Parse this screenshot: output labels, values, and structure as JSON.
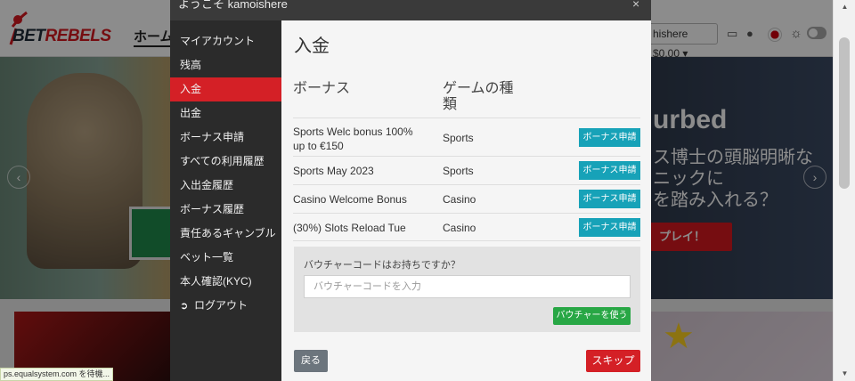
{
  "header": {
    "brand_prefix": "BET",
    "brand_suffix": "REBELS",
    "nav_home": "ホーム",
    "balance": "hishere $0.00 ▾"
  },
  "hero": {
    "title": "urbed",
    "lines": [
      "ス博士の頭脳明晰な",
      "ニックに",
      "を踏み入れる？"
    ],
    "play_button": "プレイ！",
    "prev_arrow": "‹",
    "next_arrow": "›"
  },
  "modal": {
    "welcome": "ようこそ kamoishere",
    "close": "×",
    "sidebar": [
      "マイアカウント",
      "残高",
      "入金",
      "出金",
      "ボーナス申請",
      "すべての利用履歴",
      "入出金履歴",
      "ボーナス履歴",
      "責任あるギャンブル",
      "ベット一覧",
      "本人確認(KYC)",
      "ログアウト"
    ],
    "active_item": "入金",
    "title": "入金",
    "table_headers": {
      "bonus": "ボーナス",
      "game_type": "ゲームの種類"
    },
    "bonuses": [
      {
        "name": "Sports Welc bonus 100% up to €150",
        "type": "Sports",
        "button": "ボーナス申請"
      },
      {
        "name": "Sports May 2023",
        "type": "Sports",
        "button": "ボーナス申請"
      },
      {
        "name": "Casino Welcome Bonus",
        "type": "Casino",
        "button": "ボーナス申請"
      },
      {
        "name": "(30%) Slots Reload Tue",
        "type": "Casino",
        "button": "ボーナス申請"
      }
    ],
    "voucher": {
      "label": "バウチャーコードはお持ちですか？",
      "placeholder": "バウチャーコードを入力",
      "button": "バウチャーを使う"
    },
    "back_button": "戻る",
    "skip_button": "スキップ"
  },
  "status_bar": "ps.equalsystem.com を待機...",
  "colors": {
    "brand_red": "#d42026",
    "bonus_button": "#17a2b8",
    "voucher_button": "#28a745",
    "back_button": "#6c757d",
    "sidebar_bg": "#2b2b2b"
  }
}
